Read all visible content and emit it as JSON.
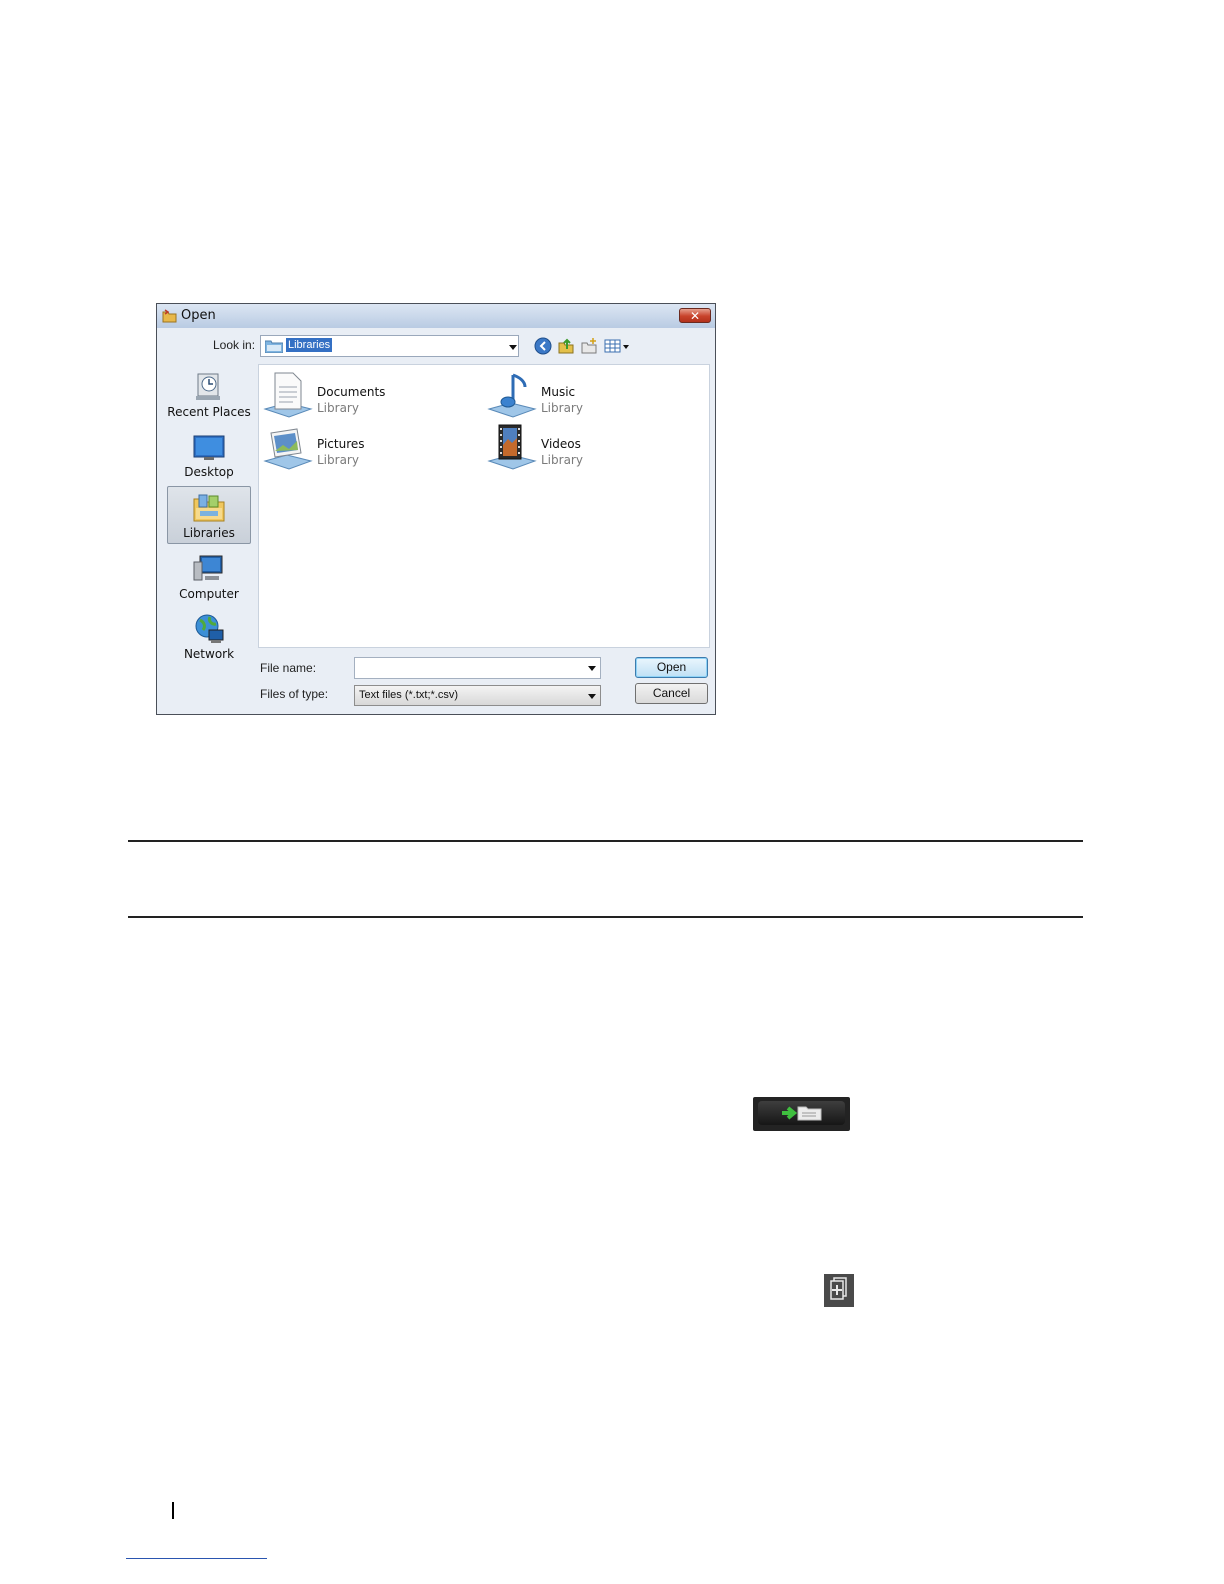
{
  "dialog": {
    "title": "Open",
    "close_label": "✕",
    "look_in_label": "Look in:",
    "look_in_value": "Libraries",
    "places": [
      {
        "label": "Recent Places",
        "icon": "recent-places-icon"
      },
      {
        "label": "Desktop",
        "icon": "desktop-icon"
      },
      {
        "label": "Libraries",
        "icon": "libraries-icon",
        "selected": true
      },
      {
        "label": "Computer",
        "icon": "computer-icon"
      },
      {
        "label": "Network",
        "icon": "network-icon"
      }
    ],
    "items": [
      {
        "name": "Documents",
        "type": "Library",
        "icon": "documents-library-icon"
      },
      {
        "name": "Music",
        "type": "Library",
        "icon": "music-library-icon"
      },
      {
        "name": "Pictures",
        "type": "Library",
        "icon": "pictures-library-icon"
      },
      {
        "name": "Videos",
        "type": "Library",
        "icon": "videos-library-icon"
      }
    ],
    "file_name_label": "File name:",
    "file_name_value": "",
    "file_type_label": "Files of type:",
    "file_type_value": "Text files (*.txt;*.csv)",
    "open_label": "Open",
    "cancel_label": "Cancel"
  },
  "colors": {
    "selection": "#3470c4",
    "dialog_bg": "#e9eef5"
  }
}
